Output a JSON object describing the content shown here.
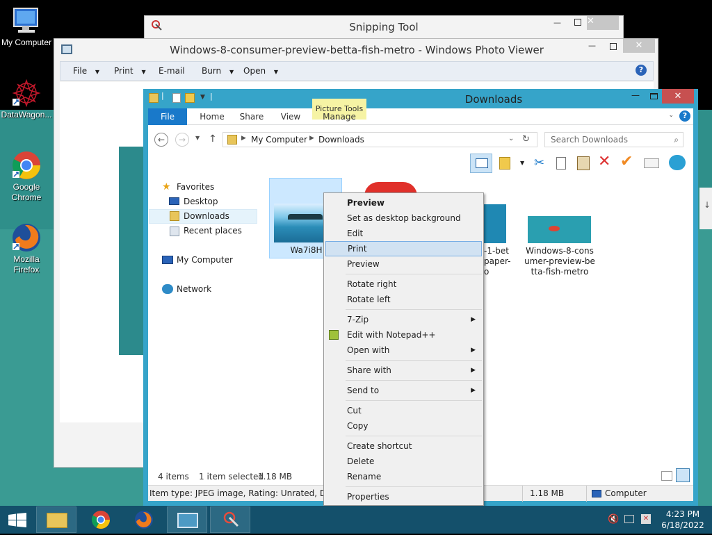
{
  "desktop": {
    "icons": [
      {
        "label": "My Computer"
      },
      {
        "label": "DataWagon..."
      },
      {
        "label": "Google Chrome"
      },
      {
        "label": "Mozilla Firefox"
      }
    ]
  },
  "snipping_tool": {
    "title": "Snipping Tool"
  },
  "photo_viewer": {
    "title": "Windows-8-consumer-preview-betta-fish-metro - Windows Photo Viewer",
    "menu": [
      "File",
      "Print",
      "E-mail",
      "Burn",
      "Open"
    ]
  },
  "explorer": {
    "title": "Downloads",
    "context_tab_group": "Picture Tools",
    "tabs": [
      "File",
      "Home",
      "Share",
      "View",
      "Manage"
    ],
    "breadcrumb": [
      "My Computer",
      "Downloads"
    ],
    "search_placeholder": "Search Downloads",
    "nav": {
      "favorites": "Favorites",
      "desktop": "Desktop",
      "downloads": "Downloads",
      "recent": "Recent places",
      "computer": "My Computer",
      "network": "Network"
    },
    "files": [
      {
        "name": "Wa7i8H"
      },
      {
        "name_lines": [
          "-1-bet",
          "paper-",
          "o"
        ]
      },
      {
        "name_lines": [
          "Windows-8-cons",
          "umer-preview-be",
          "tta-fish-metro"
        ]
      }
    ],
    "status": {
      "item_count": "4 items",
      "selected": "1 item selected",
      "size": "1.18 MB"
    },
    "details_bar": {
      "info": "Item type: JPEG image, Rating: Unrated, Dimens",
      "size": "1.18 MB",
      "zone": "Computer"
    }
  },
  "context_menu": {
    "items": [
      {
        "label": "Preview",
        "bold": true
      },
      {
        "label": "Set as desktop background"
      },
      {
        "label": "Edit"
      },
      {
        "label": "Print",
        "highlighted": true
      },
      {
        "label": "Preview"
      },
      {
        "label": "Rotate right"
      },
      {
        "label": "Rotate left"
      },
      {
        "label": "7-Zip",
        "submenu": true
      },
      {
        "label": "Edit with Notepad++"
      },
      {
        "label": "Open with",
        "submenu": true
      },
      {
        "label": "Share with",
        "submenu": true
      },
      {
        "label": "Send to",
        "submenu": true
      },
      {
        "label": "Cut"
      },
      {
        "label": "Copy"
      },
      {
        "label": "Create shortcut"
      },
      {
        "label": "Delete"
      },
      {
        "label": "Rename"
      },
      {
        "label": "Properties"
      }
    ]
  },
  "taskbar": {
    "time": "4:23 PM",
    "date": "6/18/2022"
  },
  "colors": {
    "accent": "#1979ca",
    "highlight": "#d1e2f2",
    "taskbar": "#14506b",
    "context_tab": "#f6f3a4"
  }
}
